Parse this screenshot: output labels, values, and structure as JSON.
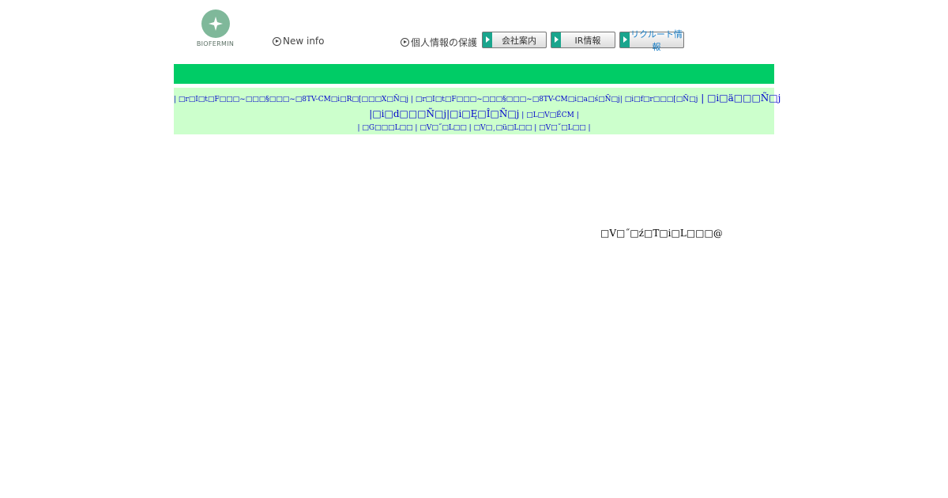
{
  "header": {
    "logo_text": "BIOFERMIN",
    "new_info": "New info",
    "privacy": "個人情報の保護",
    "buttons": [
      "会社案内",
      "IR情報",
      "リクルート情報"
    ]
  },
  "colors": {
    "green_bar": "#00cc66",
    "nav_background": "#ccffcc",
    "link": "#0000cc"
  },
  "nav": {
    "line1": [
      "□r□I□t□F□□□~□□□§□□□~□8TV-CM□i□R□[□□□X□Ñ□j",
      "□r□I□t□F□□□~□□□§□□□~□8TV-CM□i□a□ś□Ñ□j",
      "□i□f□r□□□[□Ñ□j",
      "□i□ä□□□Ñ□j"
    ],
    "line2": [
      "□i□d□□□Ñ□j",
      "□i□Ę□Î□Ñ□j",
      "□L□V□ĚCM"
    ],
    "line3": [
      "□G□□□L□□",
      "□V□˝□L□□",
      "□V□¸□ü□L□□",
      "□V□˝□L□□"
    ]
  },
  "main_text": "□V□˝□ź□T□i□L□□□@"
}
